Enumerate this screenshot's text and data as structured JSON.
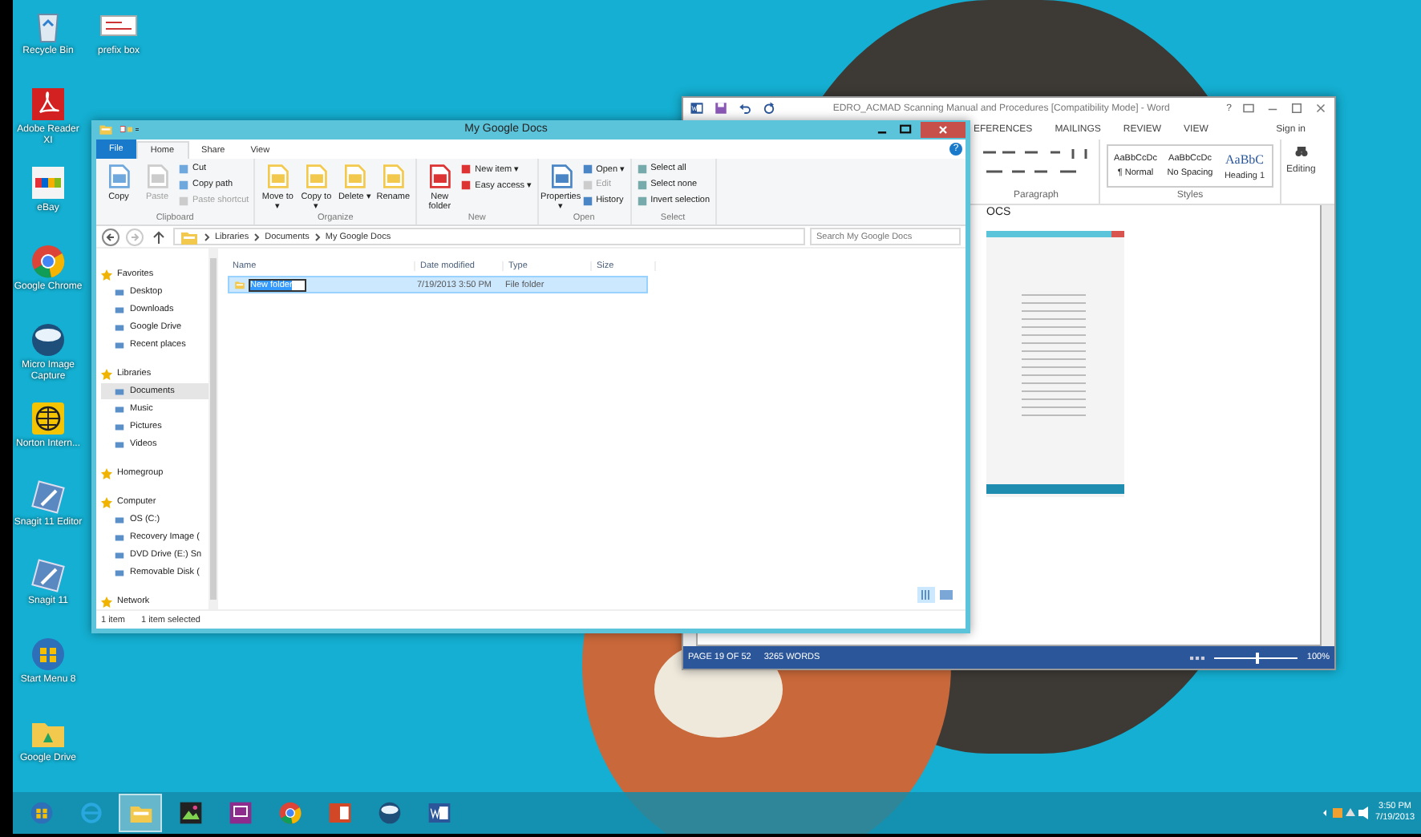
{
  "desktop_icons": [
    {
      "label": "Recycle Bin",
      "kind": "recycle"
    },
    {
      "label": "Adobe Reader XI",
      "kind": "pdf"
    },
    {
      "label": "eBay",
      "kind": "ebay"
    },
    {
      "label": "Google Chrome",
      "kind": "chrome"
    },
    {
      "label": "Micro Image Capture",
      "kind": "capture"
    },
    {
      "label": "Norton Intern...",
      "kind": "globe"
    },
    {
      "label": "Snagit 11 Editor",
      "kind": "snagit"
    },
    {
      "label": "Snagit 11",
      "kind": "snagit"
    },
    {
      "label": "Start Menu 8",
      "kind": "start"
    },
    {
      "label": "Google Drive",
      "kind": "drive"
    },
    {
      "label": "prefix box",
      "kind": "picture"
    }
  ],
  "word_window": {
    "title": "EDRO_ACMAD Scanning Manual and Procedures [Compatibility Mode] - Word",
    "help": "?",
    "tabs": [
      {
        "label": "EFERENCES",
        "selected": false
      },
      {
        "label": "MAILINGS",
        "selected": false
      },
      {
        "label": "REVIEW",
        "selected": false
      },
      {
        "label": "VIEW",
        "selected": false
      }
    ],
    "sign_in": "Sign in",
    "paragraph_group": "Paragraph",
    "styles": [
      {
        "preview": "AaBbCcDc",
        "name": "¶ Normal",
        "kind": "plain"
      },
      {
        "preview": "AaBbCcDc",
        "name": "No Spacing",
        "kind": "plain"
      },
      {
        "preview": "AaBbC",
        "name": "Heading 1",
        "kind": "heading"
      }
    ],
    "styles_group": "Styles",
    "editing": "Editing",
    "document_text": "OCS",
    "status_bar": {
      "page": "PAGE 19 OF 52",
      "words": "3265 WORDS",
      "zoom": "100%",
      "level": 0.5
    }
  },
  "explorer_window": {
    "title": "My Google Docs",
    "help": "?",
    "tabs": [
      {
        "label": "File",
        "kind": "file",
        "selected": false
      },
      {
        "label": "Home",
        "kind": "tab",
        "selected": true
      },
      {
        "label": "Share",
        "kind": "tab",
        "selected": false
      },
      {
        "label": "View",
        "kind": "tab",
        "selected": false
      }
    ],
    "ribbon_groups": [
      {
        "label": "Clipboard",
        "commands": [
          {
            "label": "Copy",
            "kind": "large",
            "disabled": false
          },
          {
            "label": "Paste",
            "kind": "large",
            "disabled": true
          },
          {
            "label": "Cut",
            "kind": "small",
            "disabled": false
          },
          {
            "label": "Copy path",
            "kind": "small",
            "disabled": false
          },
          {
            "label": "Paste shortcut",
            "kind": "small",
            "disabled": true
          }
        ]
      },
      {
        "label": "Organize",
        "commands": [
          {
            "label": "Move to ▾",
            "kind": "large",
            "disabled": false
          },
          {
            "label": "Copy to ▾",
            "kind": "large",
            "disabled": false
          },
          {
            "label": "Delete ▾",
            "kind": "large",
            "disabled": false
          },
          {
            "label": "Rename",
            "kind": "large",
            "disabled": false
          }
        ]
      },
      {
        "label": "New",
        "commands": [
          {
            "label": "New folder",
            "kind": "large",
            "disabled": false
          },
          {
            "label": "New item ▾",
            "kind": "small",
            "disabled": false
          },
          {
            "label": "Easy access ▾",
            "kind": "small",
            "disabled": false
          }
        ]
      },
      {
        "label": "Open",
        "commands": [
          {
            "label": "Properties ▾",
            "kind": "large",
            "disabled": false
          },
          {
            "label": "Open ▾",
            "kind": "small",
            "disabled": false
          },
          {
            "label": "Edit",
            "kind": "small",
            "disabled": true
          },
          {
            "label": "History",
            "kind": "small",
            "disabled": false
          }
        ]
      },
      {
        "label": "Select",
        "commands": [
          {
            "label": "Select all",
            "kind": "small",
            "disabled": false
          },
          {
            "label": "Select none",
            "kind": "small",
            "disabled": false
          },
          {
            "label": "Invert selection",
            "kind": "small",
            "disabled": false
          }
        ]
      }
    ],
    "address": [
      "Libraries",
      "Documents",
      "My Google Docs"
    ],
    "search": {
      "placeholder": "Search My Google Docs"
    },
    "navigation": [
      {
        "label": "Favorites",
        "selected": false,
        "children": [
          {
            "label": "Desktop",
            "selected": false
          },
          {
            "label": "Downloads",
            "selected": false
          },
          {
            "label": "Google Drive",
            "selected": false
          },
          {
            "label": "Recent places",
            "selected": false
          }
        ]
      },
      {
        "label": "Libraries",
        "selected": false,
        "children": [
          {
            "label": "Documents",
            "selected": true
          },
          {
            "label": "Music",
            "selected": false
          },
          {
            "label": "Pictures",
            "selected": false
          },
          {
            "label": "Videos",
            "selected": false
          }
        ]
      },
      {
        "label": "Homegroup",
        "selected": false
      },
      {
        "label": "Computer",
        "selected": false,
        "children": [
          {
            "label": "OS (C:)",
            "selected": false
          },
          {
            "label": "Recovery Image (",
            "selected": false
          },
          {
            "label": "DVD Drive (E:) Sn",
            "selected": false
          },
          {
            "label": "Removable Disk (",
            "selected": false
          }
        ]
      },
      {
        "label": "Network",
        "selected": false
      }
    ],
    "columns": [
      "Name",
      "Date modified",
      "Type",
      "Size"
    ],
    "rows": [
      {
        "name": "New folder",
        "date": "7/19/2013 3:50 PM",
        "type": "File folder",
        "selected": true,
        "editing": true
      }
    ],
    "status_bar": {
      "items": "1 item",
      "selection": "1 item selected"
    }
  },
  "taskbar": {
    "apps": [
      {
        "kind": "ie",
        "selected": false
      },
      {
        "kind": "explorer",
        "selected": true
      },
      {
        "kind": "media",
        "selected": false
      },
      {
        "kind": "reader",
        "selected": false
      },
      {
        "kind": "chrome",
        "selected": false
      },
      {
        "kind": "powerpoint",
        "selected": false
      },
      {
        "kind": "capture",
        "selected": false
      },
      {
        "kind": "word",
        "selected": false
      }
    ],
    "clock": {
      "time": "3:50 PM",
      "date": "7/19/2013"
    }
  }
}
